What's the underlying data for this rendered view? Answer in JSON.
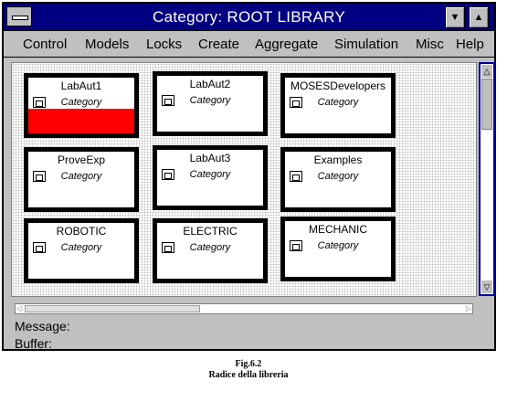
{
  "window": {
    "title": "Category: ROOT LIBRARY",
    "minimize_glyph": "▼",
    "maximize_glyph": "▲",
    "sysmenu_icon": "system-menu-icon"
  },
  "menu": {
    "items": [
      "Control",
      "Models",
      "Locks",
      "Create",
      "Aggregate",
      "Simulation",
      "Misc",
      "Help"
    ]
  },
  "cards": [
    {
      "title": "LabAut1",
      "type": "Category",
      "icon": "folder-icon",
      "highlight": true,
      "highlight_color": "#ff0000"
    },
    {
      "title": "LabAut2",
      "type": "Category",
      "icon": "folder-icon",
      "highlight": false
    },
    {
      "title": "MOSESDevelopers",
      "type": "Category",
      "icon": "folder-icon",
      "highlight": false
    },
    {
      "title": "ProveExp",
      "type": "Category",
      "icon": "folder-icon",
      "highlight": false
    },
    {
      "title": "LabAut3",
      "type": "Category",
      "icon": "folder-icon",
      "highlight": false
    },
    {
      "title": "Examples",
      "type": "Category",
      "icon": "folder-icon",
      "highlight": false
    },
    {
      "title": "ROBOTIC",
      "type": "Category",
      "icon": "folder-icon",
      "highlight": false
    },
    {
      "title": "ELECTRIC",
      "type": "Category",
      "icon": "folder-icon",
      "highlight": false
    },
    {
      "title": "MECHANIC",
      "type": "Category",
      "icon": "folder-icon",
      "highlight": false
    }
  ],
  "status": {
    "message_label": "Message:",
    "buffer_label": "Buffer:"
  },
  "caption": {
    "fig": "Fig.6.2",
    "text": "Radice della libreria"
  },
  "colors": {
    "titlebar": "#000080",
    "window_bg": "#c0c0c0",
    "scrollbar_border": "#0000a0"
  }
}
